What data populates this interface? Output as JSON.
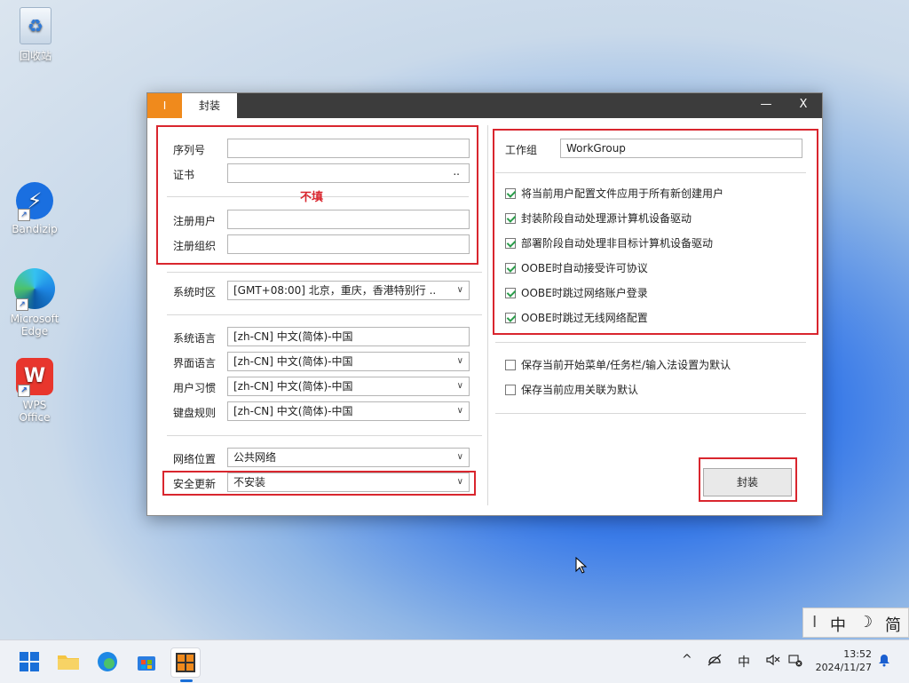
{
  "desktop": {
    "icons": [
      {
        "label": "回收站"
      },
      {
        "label": "Bandizip"
      },
      {
        "label": "Microsoft Edge"
      },
      {
        "label": "WPS Office"
      }
    ]
  },
  "window": {
    "tabs": [
      {
        "label": "I"
      },
      {
        "label": "封装"
      }
    ],
    "controls": {
      "minimize": "—",
      "close": "X"
    },
    "left": {
      "serial": {
        "label": "序列号",
        "value": ""
      },
      "cert": {
        "label": "证书",
        "value": "",
        "browse": ".."
      },
      "annotation": "不填",
      "reg_user": {
        "label": "注册用户",
        "value": ""
      },
      "reg_org": {
        "label": "注册组织",
        "value": ""
      },
      "timezone": {
        "label": "系统时区",
        "value": "[GMT+08:00] 北京，重庆，香港特别行 .."
      },
      "sys_lang": {
        "label": "系统语言",
        "value": "[zh-CN] 中文(简体)-中国"
      },
      "ui_lang": {
        "label": "界面语言",
        "value": "[zh-CN] 中文(简体)-中国"
      },
      "user_habit": {
        "label": "用户习惯",
        "value": "[zh-CN] 中文(简体)-中国"
      },
      "keyboard": {
        "label": "键盘规则",
        "value": "[zh-CN] 中文(简体)-中国"
      },
      "net_location": {
        "label": "网络位置",
        "value": "公共网络"
      },
      "security_update": {
        "label": "安全更新",
        "value": "不安装"
      }
    },
    "right": {
      "workgroup": {
        "label": "工作组",
        "value": "WorkGroup"
      },
      "options": [
        {
          "label": "将当前用户配置文件应用于所有新创建用户",
          "checked": true
        },
        {
          "label": "封装阶段自动处理源计算机设备驱动",
          "checked": true
        },
        {
          "label": "部署阶段自动处理非目标计算机设备驱动",
          "checked": true
        },
        {
          "label": "OOBE时自动接受许可协议",
          "checked": true
        },
        {
          "label": "OOBE时跳过网络账户登录",
          "checked": true
        },
        {
          "label": "OOBE时跳过无线网络配置",
          "checked": true
        }
      ],
      "extra": [
        {
          "label": "保存当前开始菜单/任务栏/输入法设置为默认",
          "checked": false
        },
        {
          "label": "保存当前应用关联为默认",
          "checked": false
        }
      ],
      "seal_button": "封装"
    }
  },
  "ime": {
    "cursor": "I",
    "lang": "中",
    "mode": "☽",
    "script": "简"
  },
  "taskbar": {
    "tray": {
      "chevron": "^",
      "ime": "中"
    },
    "clock": {
      "time": "13:52",
      "date": "2024/11/27"
    }
  }
}
